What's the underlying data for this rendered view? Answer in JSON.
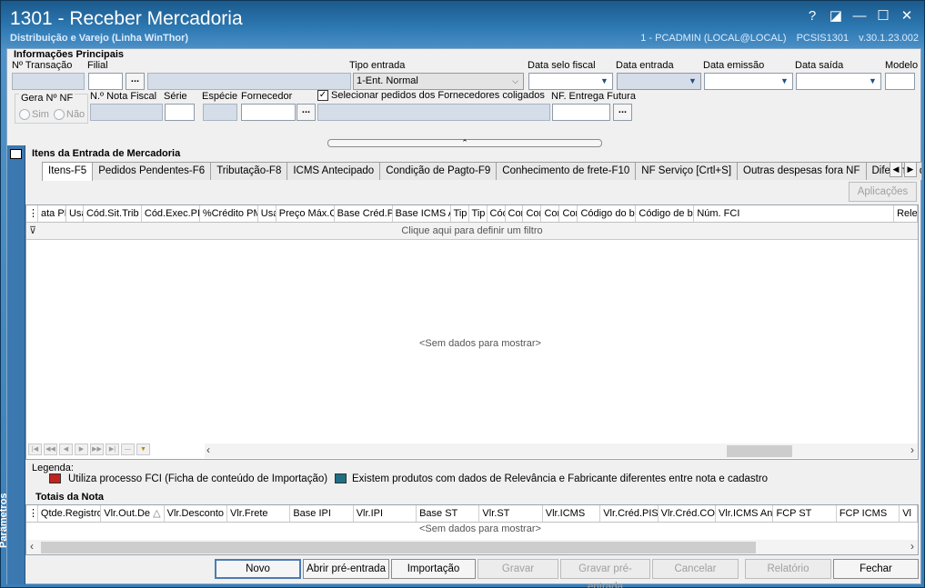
{
  "window": {
    "title": "1301 - Receber Mercadoria",
    "subtitle": "Distribuição e Varejo (Linha WinThor)",
    "status": [
      "1 - PCADMIN (LOCAL@LOCAL)",
      "PCSIS1301",
      "v.30.1.23.002"
    ],
    "controls": [
      "?",
      "◪",
      "—",
      "☐",
      "✕"
    ]
  },
  "main_info": {
    "section_title": "Informações Principais",
    "labels": {
      "transacao": "Nº Transação",
      "filial": "Filial",
      "tipo_entrada": "Tipo entrada",
      "data_selo": "Data selo fiscal",
      "data_entrada": "Data entrada",
      "data_emissao": "Data emissão",
      "data_saida": "Data saída",
      "modelo": "Modelo",
      "gera_nf": "Gera Nº NF",
      "sim": "Sim",
      "nao": "Não",
      "nota_fiscal": "N.º Nota Fiscal",
      "serie": "Série",
      "especie": "Espécie",
      "fornecedor": "Fornecedor",
      "selecionar_pedidos": "Selecionar pedidos dos Fornecedores coligados",
      "nf_entrega_futura": "NF. Entrega Futura"
    },
    "tipo_entrada_value": "1-Ent. Normal",
    "dots_label": "...",
    "selecionar_pedidos_checked": true
  },
  "items_section": {
    "title": "Itens da Entrada de Mercadoria",
    "tabs": [
      "Itens-F5",
      "Pedidos Pendentes-F6",
      "Tributação-F8",
      "ICMS Antecipado",
      "Condição de Pagto-F9",
      "Conhecimento de frete-F10",
      "NF Serviço [Crtl+S]",
      "Outras despesas fora NF",
      "Diferença de"
    ],
    "active_tab": 0,
    "aplicacoes_button": "Aplicações",
    "columns": [
      "ata PIS",
      "Usa",
      "Cód.Sit.Trib",
      "Cód.Exec.PI",
      "%Crédito PM",
      "Usa",
      "Preço Máx.C",
      "Base Créd.P",
      "Base ICMS A",
      "Tip",
      "Tip",
      "Cód",
      "Cor",
      "Cor",
      "Cor",
      "Cor",
      "Código do be",
      "Código de be",
      "Núm. FCI",
      "Relev"
    ],
    "filter_text": "Clique aqui para definir um filtro",
    "empty_text": "<Sem dados para mostrar>"
  },
  "legend": {
    "title": "Legenda:",
    "items": [
      {
        "color": "#c0241c",
        "text": "Utiliza processo FCI (Ficha de conteúdo de Importação)"
      },
      {
        "color": "#1f6e84",
        "text": "Existem produtos com dados de Relevância e Fabricante diferentes entre nota e cadastro"
      }
    ]
  },
  "totals": {
    "title": "Totais da Nota",
    "columns": [
      "Qtde.Registro",
      "Vlr.Out.De",
      "Vlr.Desconto",
      "Vlr.Frete",
      "Base IPI",
      "Vlr.IPI",
      "Base ST",
      "Vlr.ST",
      "Vlr.ICMS",
      "Vlr.Créd.PIS",
      "Vlr.Créd.CO",
      "Vlr.ICMS Ant",
      "FCP ST",
      "FCP ICMS",
      "Vl"
    ],
    "empty_text": "<Sem dados para mostrar>"
  },
  "side_panel": {
    "label": "Parâmetros"
  },
  "actions": {
    "novo": "Novo",
    "abrir_pre_entrada": "Abrir pré-entrada",
    "importacao": "Importação",
    "gravar": "Gravar",
    "gravar_pre_entrada": "Gravar pré-entrada",
    "cancelar": "Cancelar",
    "relatorio": "Relatório",
    "fechar": "Fechar"
  }
}
